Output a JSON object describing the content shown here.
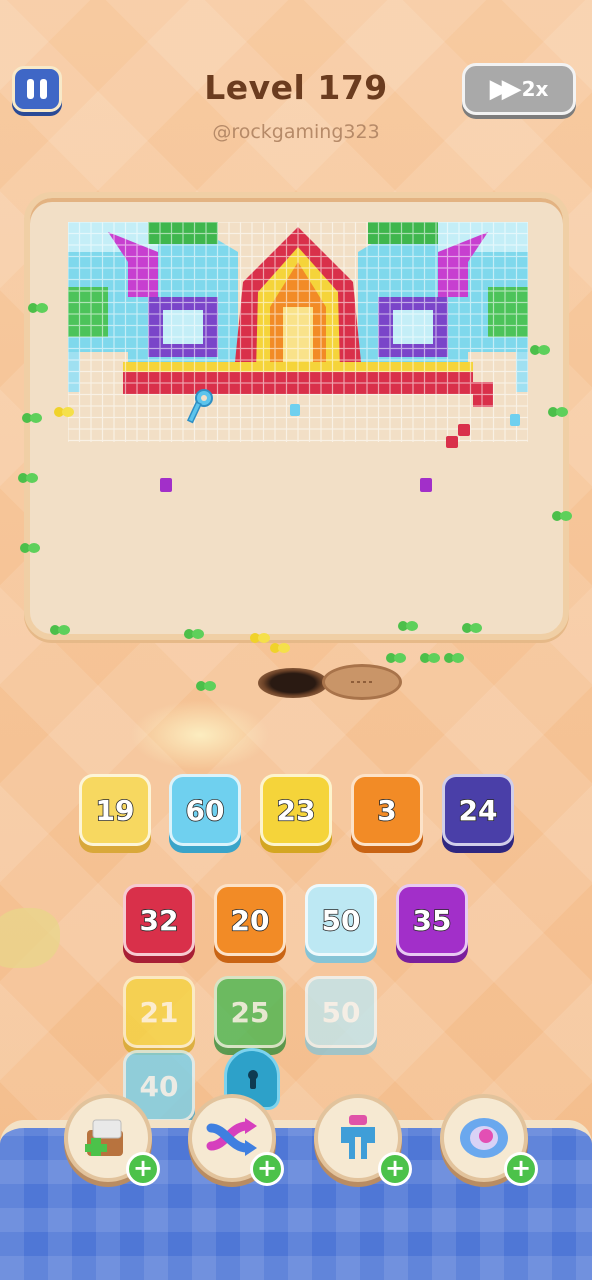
{
  "header": {
    "level_title": "Level 179",
    "username": "@rockgaming323",
    "speed_label": "2x"
  },
  "icons": {
    "pause": "pause-icon",
    "speed": "fast-forward-icon",
    "lock": "lock-icon"
  },
  "queue_row": [
    {
      "value": "19",
      "color": "#f7d860"
    },
    {
      "value": "60",
      "color": "#6fd0ef"
    },
    {
      "value": "23",
      "color": "#f5d43a"
    },
    {
      "value": "3",
      "color": "#f28b26"
    },
    {
      "value": "24",
      "color": "#4a3fa8"
    }
  ],
  "stack_rows": [
    [
      {
        "value": "32",
        "color": "#d9304a"
      },
      {
        "value": "20",
        "color": "#f28b26"
      },
      {
        "value": "50",
        "color": "#bde8f3"
      },
      {
        "value": "35",
        "color": "#a22fc9"
      }
    ],
    [
      {
        "value": "21",
        "color": "#f5d43a"
      },
      {
        "value": "25",
        "color": "#3fb64d"
      },
      {
        "value": "50",
        "color": "#bde8f3"
      }
    ],
    [
      {
        "value": "40",
        "color": "#6fd0ef"
      }
    ]
  ],
  "powerups": [
    {
      "name": "add-tray-powerup",
      "icon": "add-box-icon"
    },
    {
      "name": "shuffle-powerup",
      "icon": "shuffle-arrows-icon"
    },
    {
      "name": "magnet-powerup",
      "icon": "magnet-icon"
    },
    {
      "name": "bubble-powerup",
      "icon": "bubble-icon"
    }
  ]
}
